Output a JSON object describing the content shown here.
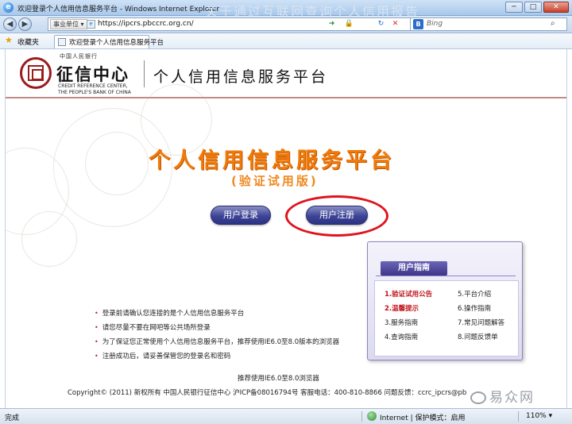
{
  "window": {
    "title": "欢迎登录个人信用信息服务平台 - Windows Internet Explorer",
    "overlay_title": "关于通过互联网查询个人信用报告",
    "minimize": "─",
    "maximize": "□",
    "close": "✕"
  },
  "nav": {
    "back": "◀",
    "forward": "▶",
    "favorite_chip": "事业单位 ▾",
    "url": "https://ipcrs.pbccrc.org.cn/",
    "search_placeholder": "Bing",
    "search_icon": "⌕"
  },
  "favbar": {
    "favorites_label": "收藏夹",
    "tab_title": "欢迎登录个人信用信息服务平台"
  },
  "header": {
    "org_top": "中国人民银行",
    "org_cn": "征信中心",
    "org_en_1": "CREDIT REFERENCE CENTER,",
    "org_en_2": "THE PEOPLE'S BANK OF CHINA",
    "platform_title": "个人信用信息服务平台"
  },
  "main": {
    "title": "个人信用信息服务平台",
    "subtitle": "(验证试用版)",
    "login_button": "用户登录",
    "register_button": "用户注册"
  },
  "guide": {
    "heading": "用户指南",
    "items": [
      {
        "label": "1.验证试用公告",
        "highlight": true
      },
      {
        "label": "5.平台介绍",
        "highlight": false
      },
      {
        "label": "2.温馨提示",
        "highlight": true
      },
      {
        "label": "6.操作指南",
        "highlight": false
      },
      {
        "label": "3.服务指南",
        "highlight": false
      },
      {
        "label": "7.常见问题解答",
        "highlight": false
      },
      {
        "label": "4.查询指南",
        "highlight": false
      },
      {
        "label": "8.问题反馈单",
        "highlight": false
      }
    ]
  },
  "notes": [
    "登录前请确认您连接的是个人信用信息服务平台",
    "请您尽量不要在网吧等公共场所登录",
    "为了保证您正常使用个人信用信息服务平台，推荐使用IE6.0至8.0版本的浏览器",
    "注册成功后，请妥善保管您的登录名和密码"
  ],
  "footer": {
    "browser_note": "推荐使用IE6.0至8.0浏览器",
    "copyright": "Copyright© (2011) 新权所有 中国人民银行征信中心 沪ICP备08016794号 客服电话：400-810-8866 问题反馈：ccrc_ipcrs@pb"
  },
  "watermark": {
    "text": "易众网"
  },
  "status": {
    "left": "完成",
    "zone": "Internet | 保护模式：启用",
    "zoom": "110% ▾"
  },
  "colors": {
    "accent_orange": "#f07b0a",
    "button_blue": "#3d4496",
    "highlight_red": "#e0141c",
    "brand_red": "#9b1c1c"
  }
}
